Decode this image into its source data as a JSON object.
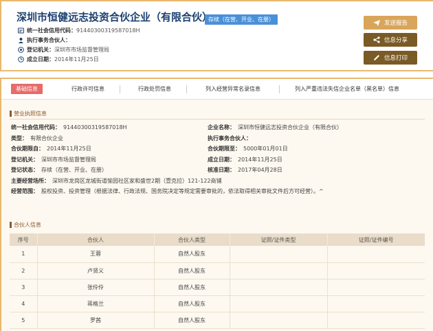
{
  "company": {
    "name": "深圳市恒健远志投资合伙企业（有限合伙）",
    "status": "存续（在营、开业、在册）"
  },
  "header_rows": [
    {
      "icon": "credit-code-icon",
      "label": "统一社会信用代码：",
      "value": "91440300319587018H"
    },
    {
      "icon": "person-icon",
      "label": "执行事务合伙人：",
      "value": ""
    },
    {
      "icon": "authority-icon",
      "label": "登记机关：",
      "value": "深圳市市场监督管理局"
    },
    {
      "icon": "calendar-icon",
      "label": "成立日期：",
      "value": "2014年11月25日"
    }
  ],
  "actions": {
    "report": "发送报告",
    "share": "信息分享",
    "print": "信息打印"
  },
  "tabs": [
    "基础信息",
    "行政许可信息",
    "行政处罚信息",
    "列入经营异常名录信息",
    "列入严重违法失信企业名单（黑名单）信息"
  ],
  "business": {
    "section_title": "营业执照信息",
    "left": [
      {
        "label": "统一社会信用代码：",
        "value": "91440300319587018H"
      },
      {
        "label": "类型：",
        "value": "有限合伙企业"
      },
      {
        "label": "合伙期限自：",
        "value": "2014年11月25日"
      },
      {
        "label": "登记机关：",
        "value": "深圳市市场监督管理局"
      },
      {
        "label": "登记状态：",
        "value": "存续（在营、开业、在册）"
      }
    ],
    "right": [
      {
        "label": "企业名称：",
        "value": "深圳市恒健远志投资合伙企业（有限合伙）"
      },
      {
        "label": "执行事务合伙人：",
        "value": ""
      },
      {
        "label": "合伙期限至：",
        "value": "5000年01月01日"
      },
      {
        "label": "成立日期：",
        "value": "2014年11月25日"
      },
      {
        "label": "核准日期：",
        "value": "2017年04月28日"
      }
    ],
    "location_label": "主要经营场所：",
    "location_value": "深圳市龙岗区龙城街道愉园社区家和盛世2期（壹克拉）121-122商铺",
    "scope_label": "经营范围：",
    "scope_value": "股权投资、投资管理（根据法律、行政法规、国务院决定等规定需要审批的，依法取得相关审批文件后方可经营）。^"
  },
  "partners": {
    "section_title": "合伙人信息",
    "headers": [
      "序号",
      "合伙人",
      "合伙人类型",
      "证照/证件类型",
      "证照/证件编号"
    ],
    "rows": [
      {
        "no": "1",
        "name": "王蓉",
        "type": "自然人股东",
        "cert_type": "",
        "cert_no": ""
      },
      {
        "no": "2",
        "name": "卢贤义",
        "type": "自然人股东",
        "cert_type": "",
        "cert_no": ""
      },
      {
        "no": "3",
        "name": "张伶伶",
        "type": "自然人股东",
        "cert_type": "",
        "cert_no": ""
      },
      {
        "no": "4",
        "name": "蒋格兰",
        "type": "自然人股东",
        "cert_type": "",
        "cert_no": ""
      },
      {
        "no": "5",
        "name": "罗茜",
        "type": "自然人股东",
        "cert_type": "",
        "cert_no": ""
      }
    ]
  }
}
